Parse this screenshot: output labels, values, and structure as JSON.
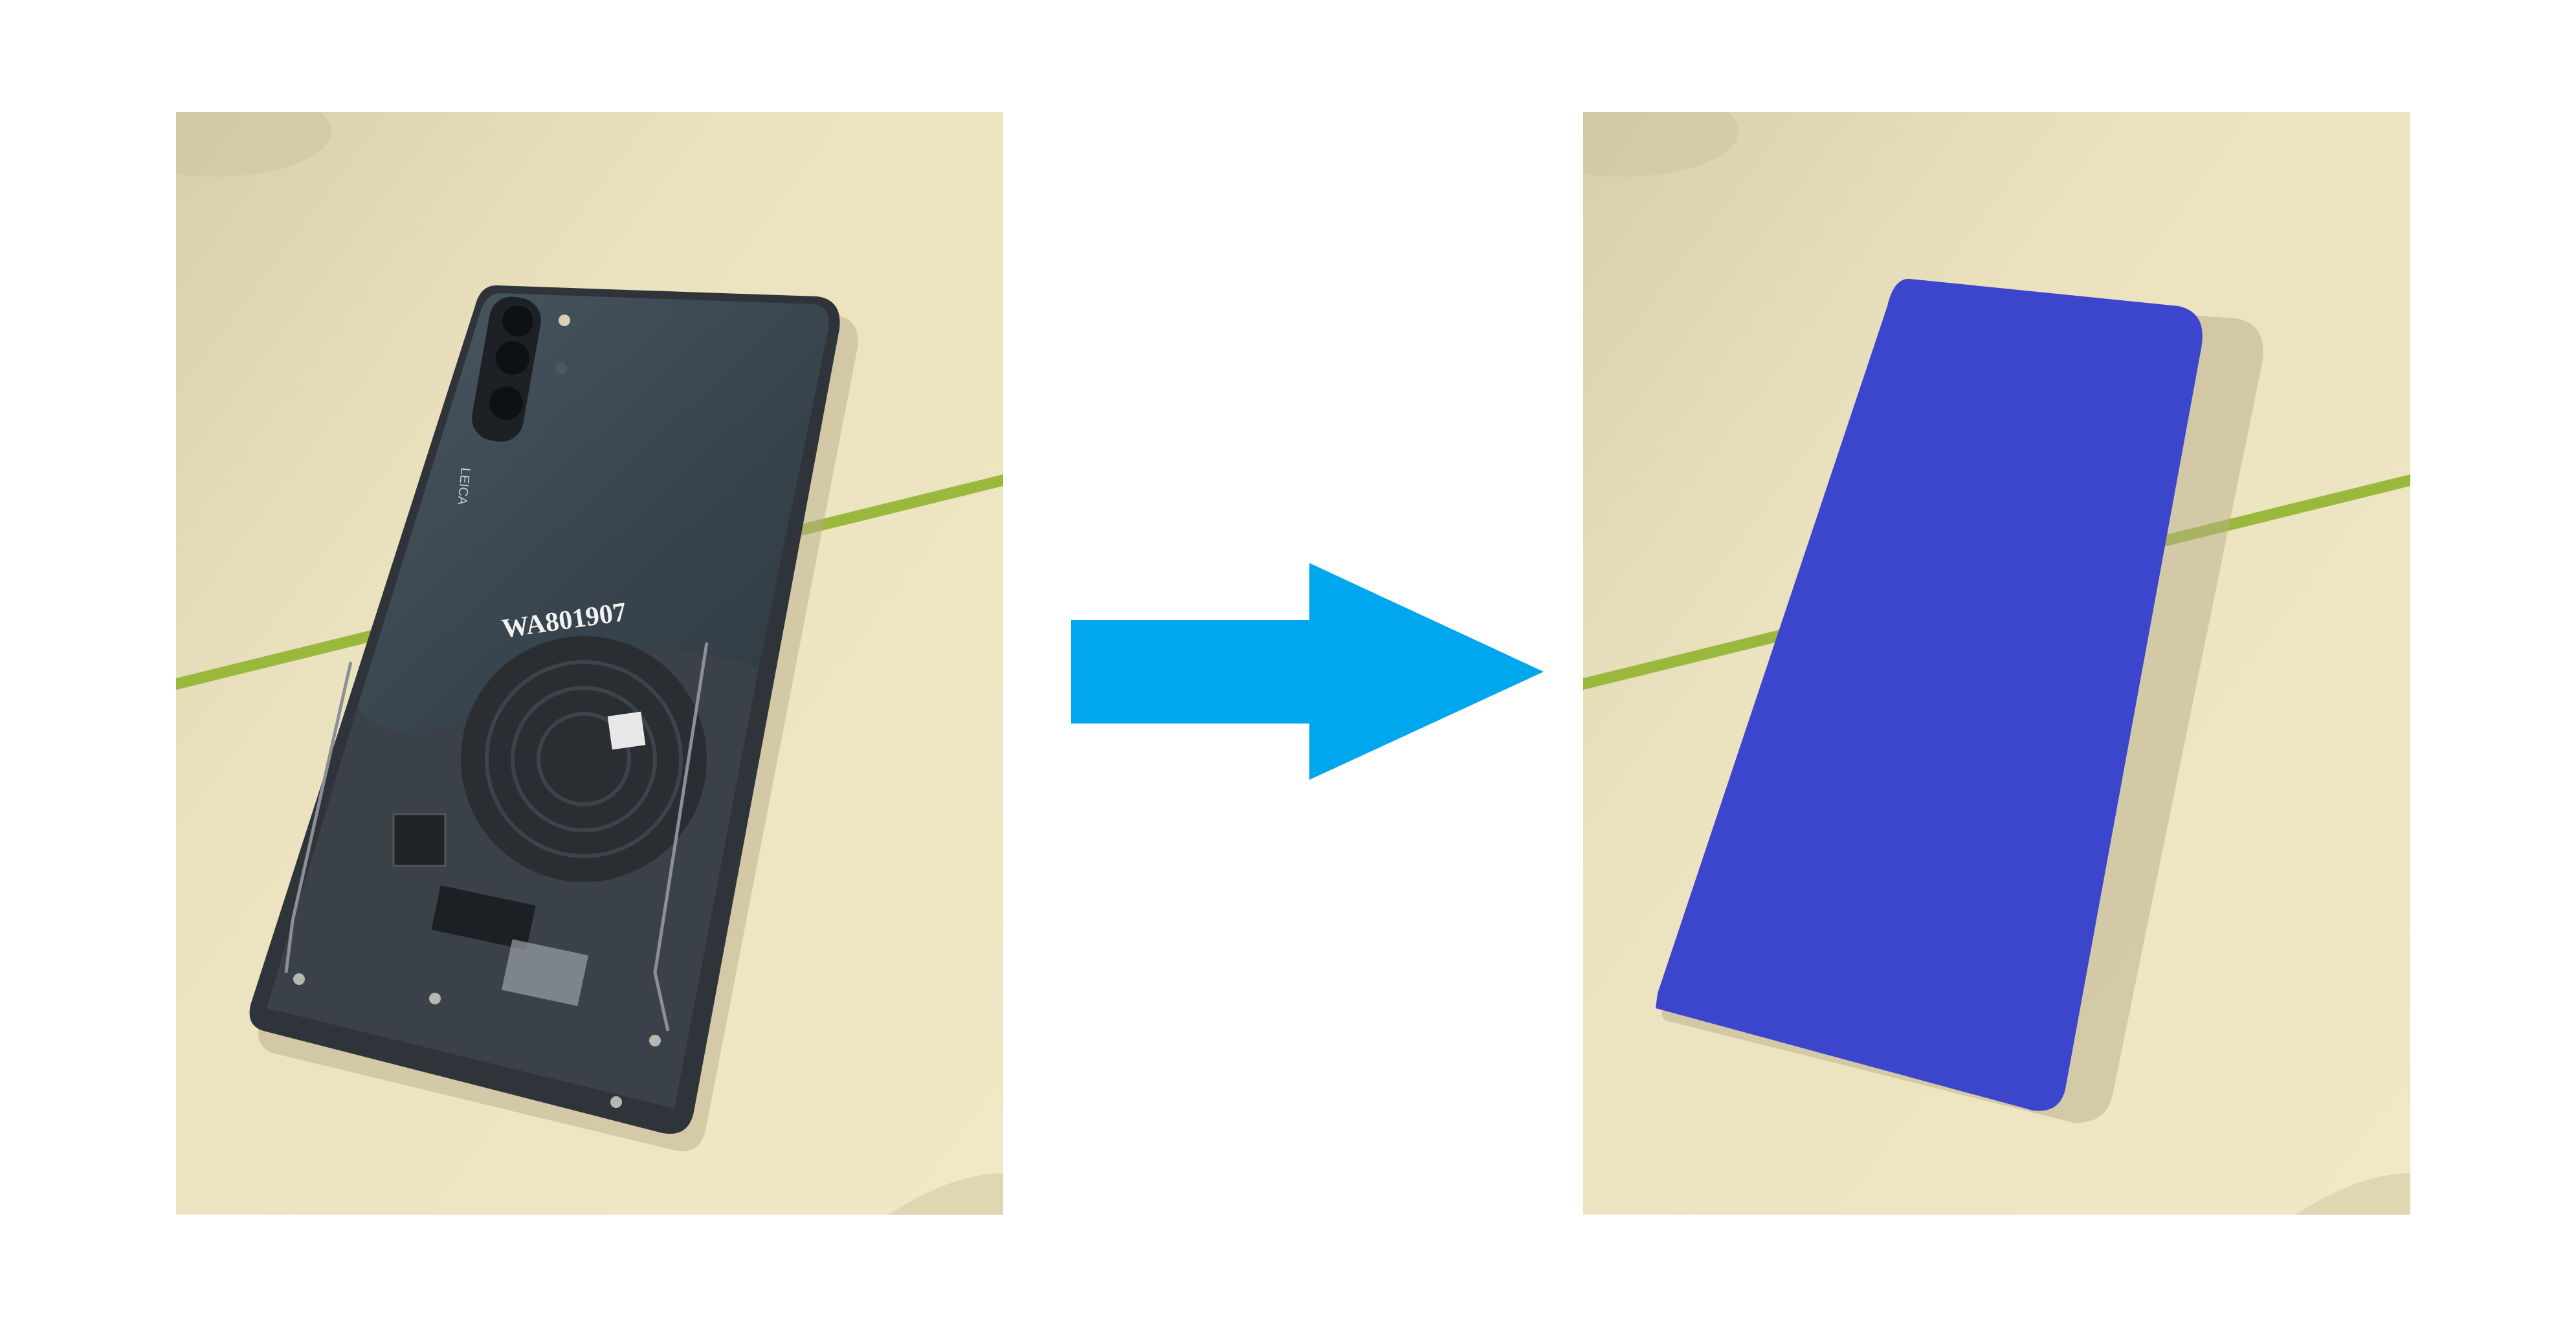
{
  "left_photo": {
    "coil_label": "WA801907",
    "brand_text": "LEICA",
    "colors": {
      "table": "#ece3be",
      "phone_body": "#39454f",
      "stripe": "#9ab83c"
    }
  },
  "arrow": {
    "icon": "right-arrow-icon",
    "color": "#00a6ee"
  },
  "right_photo": {
    "colors": {
      "table": "#ece3be",
      "mask": "#3c46cd",
      "stripe": "#9ab83c"
    }
  }
}
